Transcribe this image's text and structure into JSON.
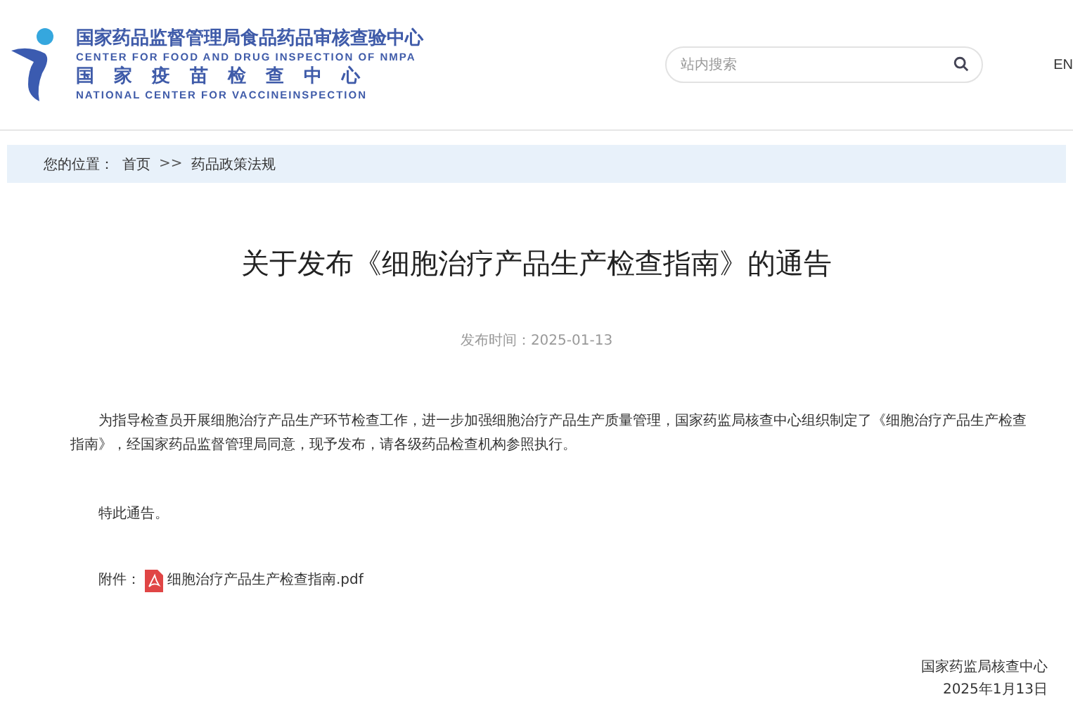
{
  "header": {
    "logo_cn": "国家药品监督管理局食品药品审核查验中心",
    "logo_en": "CENTER FOR FOOD AND DRUG INSPECTION OF NMPA",
    "logo_cn2": "国家疫苗检查中心",
    "logo_en2": "NATIONAL CENTER FOR VACCINEINSPECTION",
    "search": {
      "placeholder": "站内搜索"
    },
    "language": "EN"
  },
  "breadcrumb": {
    "label": "您的位置：",
    "items": [
      "首页",
      "药品政策法规"
    ],
    "separator": ">>"
  },
  "article": {
    "title": "关于发布《细胞治疗产品生产检查指南》的通告",
    "date": "发布时间：2025-01-13",
    "paragraphs": [
      "为指导检查员开展细胞治疗产品生产环节检查工作，进一步加强细胞治疗产品生产质量管理，国家药监局核查中心组织制定了《细胞治疗产品生产检查指南》，经国家药品监督管理局同意，现予发布，请各级药品检查机构参照执行。",
      "特此通告。"
    ],
    "attachment": {
      "label": "附件：",
      "file": "细胞治疗产品生产检查指南.pdf"
    },
    "signature": "国家药监局核查中心",
    "signed_date": "2025年1月13日"
  }
}
